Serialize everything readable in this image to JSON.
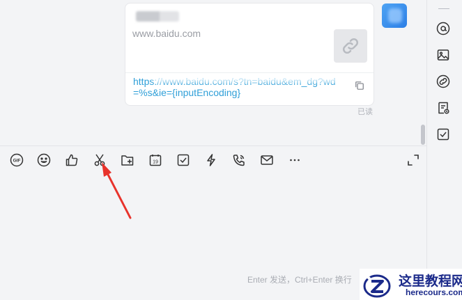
{
  "message_card": {
    "domain": "www.baidu.com",
    "url": "https://www.baidu.com/s?tn=baidu&em_dg?wd=%s&ie={inputEncoding}",
    "read_status": "已读",
    "thumbnail_icon": "link-icon",
    "copy_icon": "copy-icon"
  },
  "toolbar": {
    "items": [
      {
        "name": "gif-icon"
      },
      {
        "name": "emoji-icon"
      },
      {
        "name": "thumbs-up-icon"
      },
      {
        "name": "scissors-icon"
      },
      {
        "name": "folder-add-icon"
      },
      {
        "name": "calendar-icon",
        "text": "19"
      },
      {
        "name": "checkbox-icon"
      },
      {
        "name": "lightning-icon"
      },
      {
        "name": "phone-icon"
      },
      {
        "name": "mail-icon"
      },
      {
        "name": "more-icon"
      },
      {
        "name": "expand-icon"
      }
    ]
  },
  "right_sidebar": {
    "items": [
      "at-icon",
      "image-icon",
      "link-icon",
      "document-icon",
      "checkbox-icon"
    ]
  },
  "input": {
    "hint": "Enter 发送，Ctrl+Enter 换行"
  },
  "annotation": {
    "arrow_color": "#e8332c"
  },
  "watermark": {
    "title": "这里教程网",
    "subtitle": "herecours.com"
  }
}
